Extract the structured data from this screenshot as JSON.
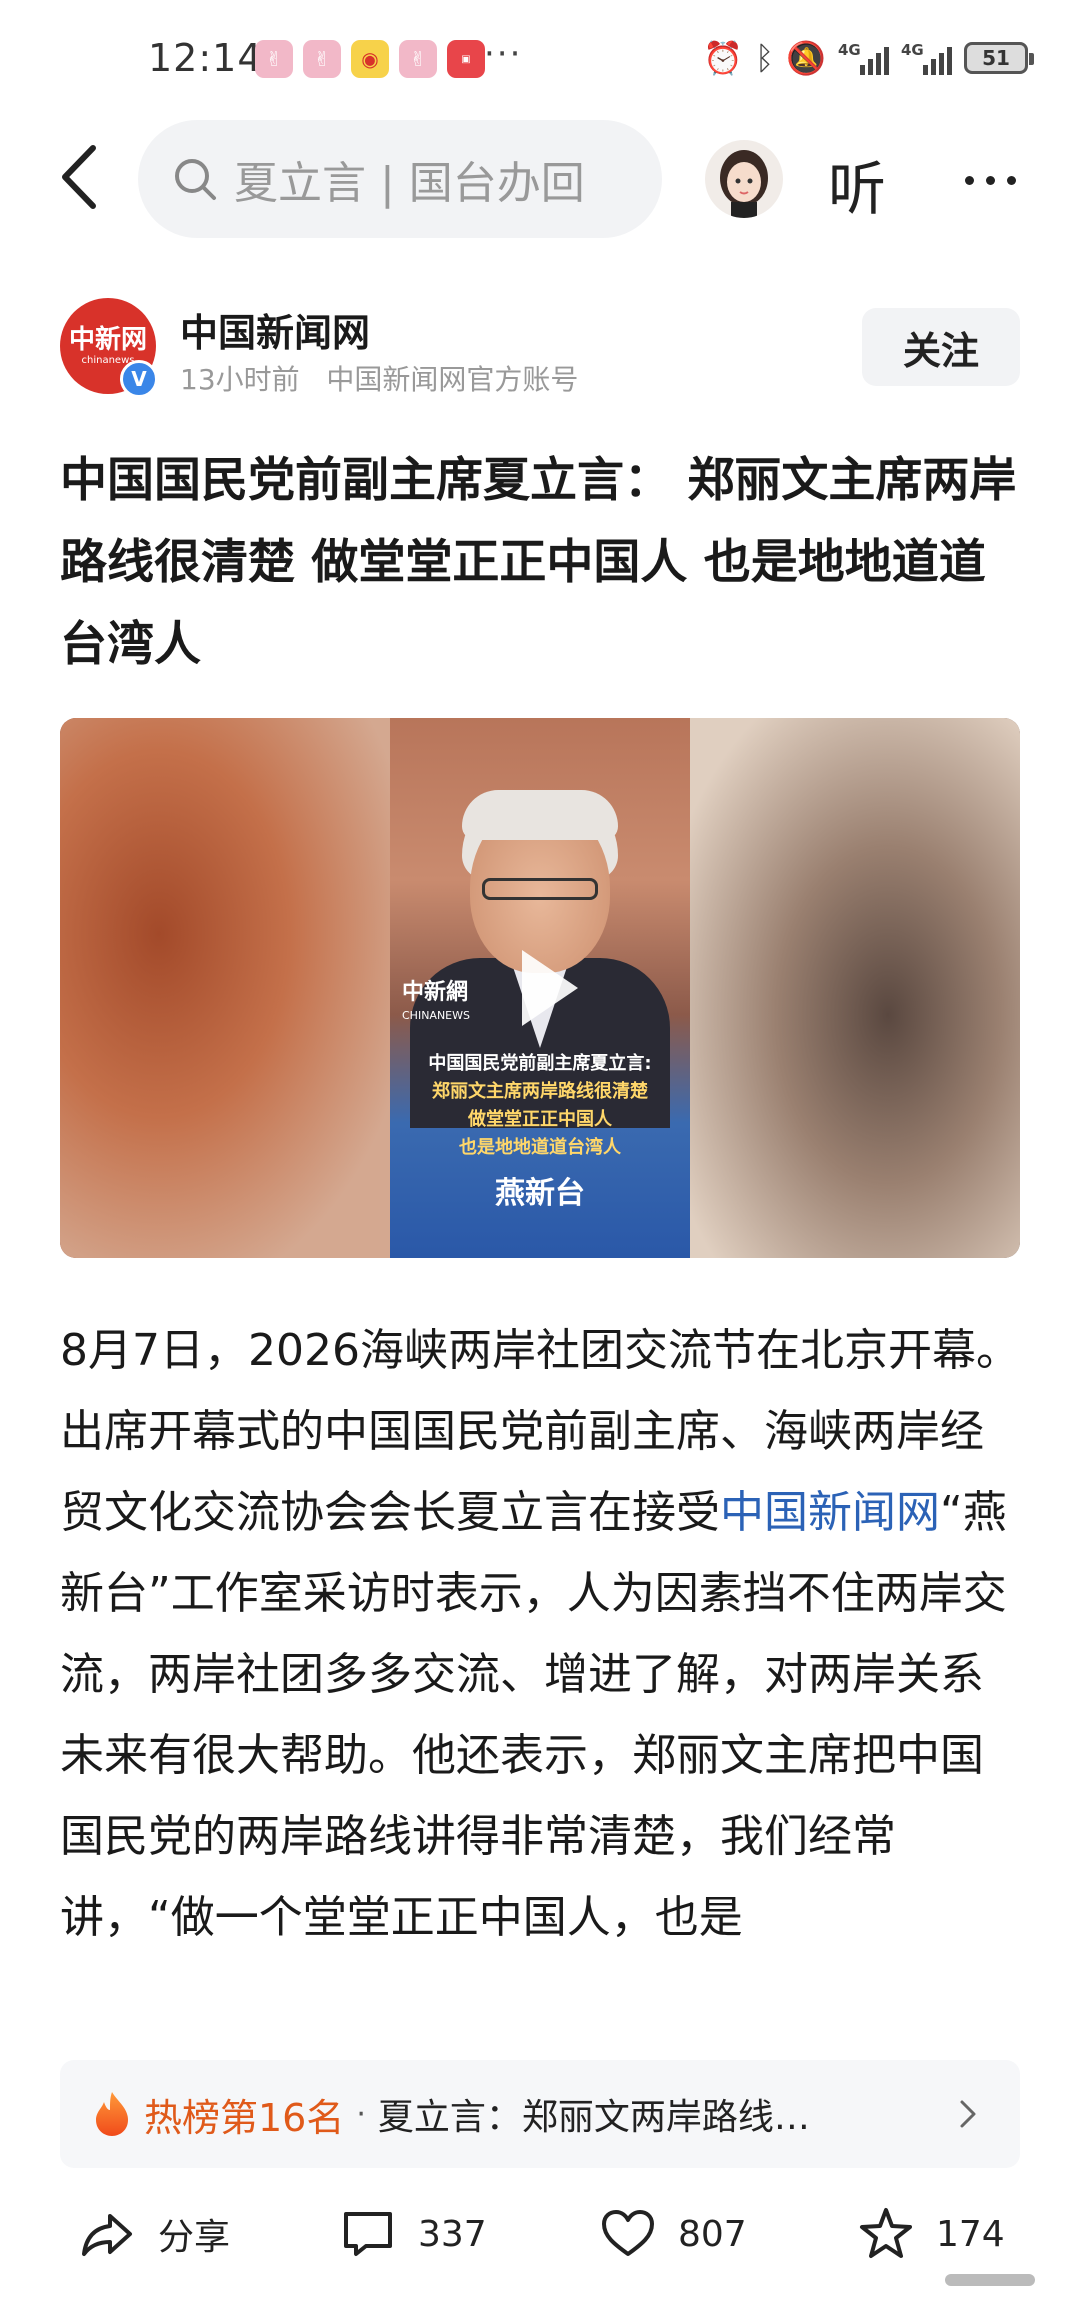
{
  "status_bar": {
    "time": "12:14",
    "more": "···",
    "network1": "4G",
    "network2": "4G",
    "battery": "51"
  },
  "header": {
    "search_placeholder": "夏立言 | 国台办回",
    "listen_label": "听"
  },
  "author": {
    "logo_cn": "中新网",
    "logo_en": "chinanews",
    "verified_mark": "V",
    "name": "中国新闻网",
    "time_ago": "13小时前",
    "account_desc": "中国新闻网官方账号",
    "follow_label": "关注"
  },
  "article": {
    "title": "中国国民党前副主席夏立言： 郑丽文主席两岸路线很清楚 做堂堂正正中国人 也是地地道道台湾人",
    "video": {
      "brand_cn": "中新網",
      "brand_en": "CHINANEWS",
      "caption_line1": "中国国民党前副主席夏立言:",
      "caption_line2": "郑丽文主席两岸路线很清楚",
      "caption_line3": "做堂堂正正中国人",
      "caption_line4": "也是地地道道台湾人",
      "studio": "燕新台"
    },
    "body_part1": "8月7日，2026海峡两岸社团交流节在北京开幕。出席开幕式的中国国民党前副主席、海峡两岸经贸文化交流协会会长夏立言在接受",
    "body_link": "中国新闻网",
    "body_part2": "“燕新台”工作室采访时表示，人为因素挡不住两岸交流，两岸社团多多交流、增进了解，对两岸关系未来有很大帮助。他还表示，郑丽文主席把中国国民党的两岸路线讲得非常清楚，我们经常讲，“做一个堂堂正正中国人，也是"
  },
  "hot": {
    "rank": "热榜第16名",
    "separator": "·",
    "title": "夏立言：郑丽文两岸路线…"
  },
  "actions": {
    "share_label": "分享",
    "comments": "337",
    "likes": "807",
    "favorites": "174"
  },
  "colors": {
    "link": "#2b62b6",
    "hot": "#e05a1a",
    "brand_red": "#d8322a",
    "verified": "#3a86e8"
  }
}
